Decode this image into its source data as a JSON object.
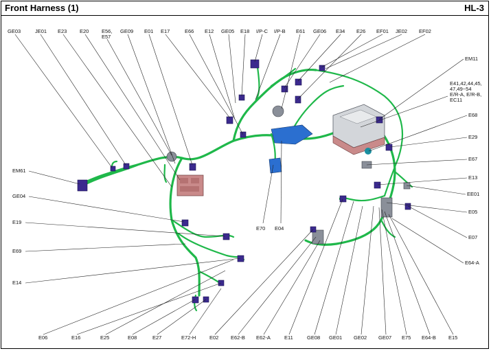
{
  "header": {
    "title": "Front Harness (1)",
    "page_id": "HL-3"
  },
  "colors": {
    "harness": "#1fb84a",
    "connector": "#3b2a8e",
    "junction_block": "#c98a8a",
    "bracket": "#2b6fd0"
  },
  "labels": {
    "ge03": "GE03",
    "je01": "JE01",
    "e23": "E23",
    "e20": "E20",
    "e56_57": "E56,\nE57",
    "ge09": "GE09",
    "e01": "E01",
    "e17": "E17",
    "e66": "E66",
    "e12": "E12",
    "ge05": "GE05",
    "e18": "E18",
    "ip_c": "I/P-C",
    "ip_b": "I/P-B",
    "e61": "E61",
    "ge06": "GE06",
    "e34": "E34",
    "e26": "E26",
    "ef01": "EF01",
    "je02": "JE02",
    "ef02": "EF02",
    "em11": "EM11",
    "e41_line1": "E41,42,44,45,",
    "e41_line2": "47,49~54",
    "e41_line3": "E/R-A, E/R-B,",
    "e41_line4": "EC11",
    "e68": "E68",
    "e29": "E29",
    "e67": "E67",
    "e13": "E13",
    "ee01": "EE01",
    "e05": "E05",
    "e07": "E07",
    "e64_a": "E64-A",
    "em61": "EM61",
    "ge04": "GE04",
    "e19": "E19",
    "e69": "E69",
    "e14": "E14",
    "e70": "E70",
    "e04": "E04",
    "e06": "E06",
    "e16": "E16",
    "e25": "E25",
    "e08": "E08",
    "e27": "E27",
    "e72_h": "E72-H",
    "e02": "E02",
    "e62_b": "E62-B",
    "e62_a": "E62-A",
    "e11": "E11",
    "ge08": "GE08",
    "ge01": "GE01",
    "ge02": "GE02",
    "ge07": "GE07",
    "e75": "E75",
    "e64_b": "E64-B",
    "e15": "E15"
  }
}
